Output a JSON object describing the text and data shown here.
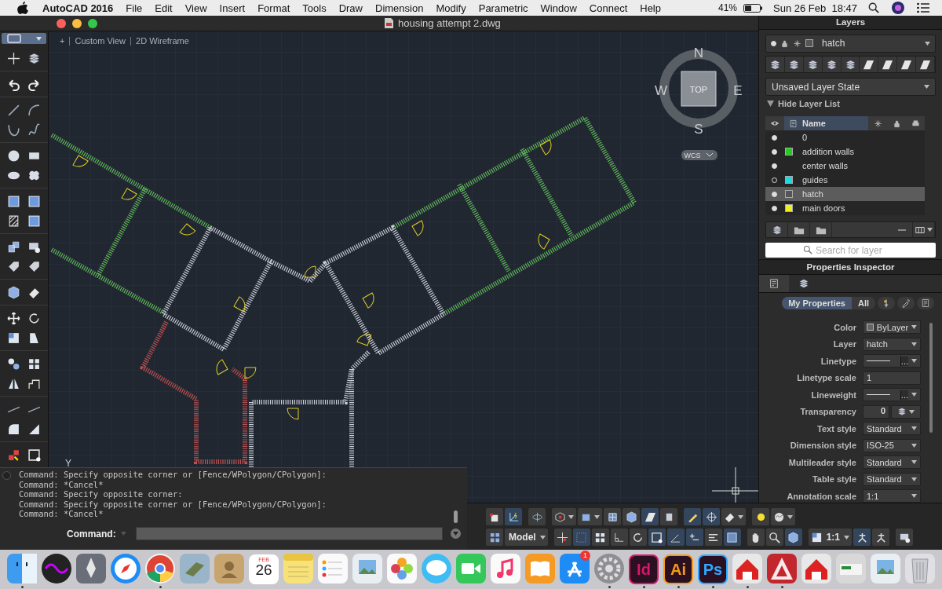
{
  "menu_bar": {
    "app_name": "AutoCAD 2016",
    "menus": [
      "File",
      "Edit",
      "View",
      "Insert",
      "Format",
      "Tools",
      "Draw",
      "Dimension",
      "Modify",
      "Parametric",
      "Window",
      "Connect",
      "Help"
    ],
    "battery": "41%",
    "clock": "Sun 26 Feb  18:47"
  },
  "window": {
    "title": "housing attempt 2.dwg"
  },
  "viewport": {
    "controls": "+",
    "view": "Custom View",
    "visual_style": "2D Wireframe",
    "ucs_label": "Y"
  },
  "viewcube": {
    "face": "TOP",
    "north": "N",
    "south": "S",
    "east": "E",
    "west": "W",
    "coordinate_system": "WCS"
  },
  "layers_panel": {
    "title": "Layers",
    "current_layer": "hatch",
    "layer_state": "Unsaved Layer State",
    "list_toggle": {
      "label": "Hide Layer List",
      "expanded": true
    },
    "name_column": "Name",
    "layers": [
      {
        "name": "0",
        "on": true,
        "selected": false
      },
      {
        "name": "addition walls",
        "color": "#22cc22",
        "on": true,
        "selected": false
      },
      {
        "name": "center walls",
        "on": true,
        "selected": false
      },
      {
        "name": "guides",
        "color": "#22d8e0",
        "on": false,
        "selected": false
      },
      {
        "name": "hatch",
        "color": "#555555",
        "on": true,
        "selected": true
      },
      {
        "name": "main doors",
        "color": "#eeee22",
        "on": true,
        "selected": false
      }
    ],
    "search": {
      "placeholder": "Search for layer"
    }
  },
  "properties_panel": {
    "title": "Properties Inspector",
    "tabs": [
      {
        "kind": "properties",
        "selected": true
      },
      {
        "kind": "layers",
        "selected": false
      }
    ],
    "filters": [
      {
        "label": "My Properties",
        "selected": true
      },
      {
        "label": "All",
        "selected": false
      }
    ],
    "rows": [
      {
        "label": "Color",
        "kind": "swatch",
        "value": "ByLayer"
      },
      {
        "label": "Layer",
        "kind": "dropdown",
        "value": "hatch"
      },
      {
        "label": "Linetype",
        "kind": "line",
        "value": "..."
      },
      {
        "label": "Linetype scale",
        "kind": "field",
        "value": "1"
      },
      {
        "label": "Lineweight",
        "kind": "line",
        "value": "..."
      },
      {
        "label": "Transparency",
        "kind": "transparency",
        "value": "0"
      },
      {
        "label": "Text style",
        "kind": "dropdown",
        "value": "Standard"
      },
      {
        "label": "Dimension style",
        "kind": "dropdown",
        "value": "ISO-25"
      },
      {
        "label": "Multileader style",
        "kind": "dropdown",
        "value": "Standard"
      },
      {
        "label": "Table style",
        "kind": "dropdown",
        "value": "Standard"
      },
      {
        "label": "Annotation scale",
        "kind": "dropdown",
        "value": "1:1"
      }
    ]
  },
  "command_line": {
    "history": [
      "Command: Specify opposite corner or [Fence/WPolygon/CPolygon]:",
      "Command: *Cancel*",
      "Command: Specify opposite corner:",
      "Command: Specify opposite corner or [Fence/WPolygon/CPolygon]:",
      "Command: *Cancel*"
    ],
    "prompt": "Command:"
  },
  "status_toolbar": {
    "rows": [
      [
        [
          {
            "kind": "box",
            "on": false
          },
          {
            "kind": "axes",
            "on": true
          }
        ],
        [
          {
            "kind": "orbit",
            "on": false
          }
        ],
        [
          {
            "kind": "visual-style",
            "on": false,
            "menu": true
          },
          {
            "kind": "solid",
            "on": false,
            "menu": true
          },
          {
            "kind": "grid-cube",
            "on": false
          },
          {
            "kind": "cube",
            "on": false
          },
          {
            "kind": "plane",
            "on": true
          },
          {
            "kind": "cylinder",
            "on": false
          }
        ],
        [
          {
            "kind": "pencil",
            "on": true
          },
          {
            "kind": "target",
            "on": true
          },
          {
            "kind": "eraser",
            "on": false,
            "menu": true
          }
        ],
        [
          {
            "kind": "sun",
            "on": false
          },
          {
            "kind": "dome",
            "on": false,
            "menu": true
          }
        ]
      ],
      [
        [
          {
            "kind": "tiles",
            "on": false
          },
          {
            "kind": "text",
            "label": "Model",
            "on": false,
            "menu": true
          }
        ],
        [
          {
            "kind": "snap",
            "on": false
          },
          {
            "kind": "dots",
            "on": true
          },
          {
            "kind": "grid",
            "on": false
          },
          {
            "kind": "ortho",
            "on": false
          },
          {
            "kind": "rotate",
            "on": false
          },
          {
            "kind": "frame",
            "on": true
          },
          {
            "kind": "angle",
            "on": true
          },
          {
            "kind": "plus-lines",
            "on": true
          },
          {
            "kind": "lines",
            "on": false
          },
          {
            "kind": "fill",
            "on": true
          }
        ],
        [
          {
            "kind": "hand",
            "on": false
          },
          {
            "kind": "magnifier",
            "on": false
          },
          {
            "kind": "cube",
            "on": true
          }
        ],
        [
          {
            "kind": "scale",
            "label": "1:1",
            "on": false,
            "menu": true
          },
          {
            "kind": "person",
            "on": true
          },
          {
            "kind": "person",
            "on": false
          }
        ],
        [
          {
            "kind": "screen",
            "on": false
          }
        ]
      ]
    ]
  },
  "dock": {
    "items": [
      {
        "kind": "finder",
        "running": true
      },
      {
        "kind": "siri",
        "running": false
      },
      {
        "kind": "rocket",
        "running": false
      },
      {
        "kind": "compass",
        "running": false
      },
      {
        "kind": "chrome",
        "running": true
      },
      {
        "kind": "stamp",
        "running": false
      },
      {
        "kind": "contacts",
        "running": false
      },
      {
        "kind": "calendar",
        "month": "FEB",
        "day": "26",
        "running": false
      },
      {
        "kind": "notes",
        "running": false
      },
      {
        "kind": "reminders",
        "running": false
      },
      {
        "kind": "preview",
        "running": false
      },
      {
        "kind": "photos",
        "running": false
      },
      {
        "kind": "messages",
        "running": false
      },
      {
        "kind": "facetime",
        "running": false
      },
      {
        "kind": "music",
        "running": false
      },
      {
        "kind": "books",
        "running": false
      },
      {
        "kind": "appstore",
        "badge": "1",
        "running": false
      },
      {
        "kind": "settings",
        "running": true
      },
      {
        "kind": "lettered",
        "label": "Id",
        "color": "#d6176b",
        "running": true
      },
      {
        "kind": "lettered",
        "label": "Ai",
        "color": "#f29a1e",
        "running": true
      },
      {
        "kind": "lettered",
        "label": "Ps",
        "color": "#31a8ff",
        "running": true
      },
      {
        "kind": "sketch",
        "running": true
      },
      {
        "kind": "autocad",
        "running": true
      },
      {
        "kind": "sketch",
        "running": false
      },
      {
        "kind": "scanner",
        "running": false
      },
      {
        "kind": "preview",
        "running": false
      },
      {
        "kind": "trash",
        "running": false
      }
    ]
  }
}
